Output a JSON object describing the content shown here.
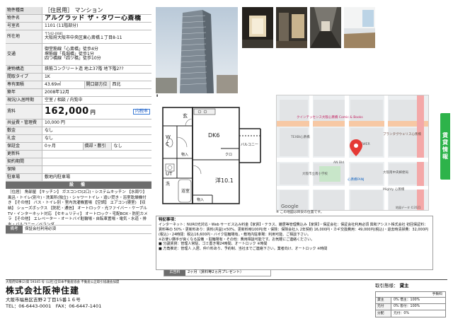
{
  "spec": {
    "type_label": "物件種目",
    "type_value": "［住居用］ マンション",
    "name_label": "物件名",
    "name_value": "アルグラッド ザ・タワー心斎橋",
    "room_label": "号室名",
    "room_value": "1101 (11階部分)",
    "location_label": "所在地",
    "postal": "〒542-0081",
    "address": "大阪府大阪市中央区東心斎橋１丁目8-11",
    "traffic_label": "交通",
    "traffic": [
      "御堂筋線「心斎橋」徒歩4分",
      "堺筋線「長堀橋」徒歩1分",
      "四つ橋線「四ツ橋」徒歩10分"
    ],
    "structure_label": "建物構造",
    "structure_value": "鉄筋コンクリート造 地上37階 地下階2??",
    "layout_label": "間取タイプ",
    "layout_value": "1K",
    "area_label": "専有面積",
    "area_value": "43.69㎡",
    "direction_label": "開口部方位",
    "direction_value": "西北",
    "built_label": "築年",
    "built_value": "2008年12月",
    "status_label": "現況/入居時期",
    "status_value": "空室 / 相談 / 内覧中",
    "rent_label": "賃料",
    "rent_value": "162,000",
    "rent_unit": "円",
    "tax_badge": "内税率",
    "mgmt_label": "共益費・管理費",
    "mgmt_value": "10,000 円",
    "deposit_label": "敷金",
    "deposit_value": "なし",
    "key_label": "礼金",
    "key_value": "なし",
    "guarantee_label": "保証金",
    "guarantee_value": "0ヶ月",
    "amort_label": "償却・敷引",
    "amort_value": "なし",
    "renewal_label": "更新料",
    "renewal_value": "",
    "contract_label": "契約期間",
    "contract_value": "",
    "insurance_label": "保険",
    "insurance_value": "",
    "parking_label": "駐車場",
    "parking_value": "敷地内駐車場",
    "equip_head": "設 備",
    "equipment": "［住居］ 角部屋 【キッチン】 ガスコンロ(2口)・システムキッチン 【水周り】 風呂・トイレ(別々)・洗面所(独立)・シャワートイレ・追い焚き・浴室乾燥機付き 【その他】 バス・トイレ別・室内洗濯機置場 【空調】 エアコン(寝室) 【収納】 シューズボックス 【防犯・通信】 オートロック・光ファイバー・ケーブルTV・インターネット対応 【セキュリティ】 オートロック・宅配BOX・防犯カメラ 【その他】 エレベーター・オートバイ駐輪場・自転車置場・電気・水道・排水・バルコニー／ベランダ",
    "remarks_label": "備考",
    "remarks_value": "保証会社利用必須"
  },
  "floorplan": {
    "north_label": "N",
    "rooms": {
      "genkan": "玄",
      "wc": "W\nC",
      "dk": "DK6",
      "balcony": "バルコニー",
      "closet_top": "物入",
      "closet": "クロ",
      "ut": "UT",
      "washer": "洗",
      "bath": "浴室",
      "western": "洋10.1",
      "storage_bottom": "物入"
    }
  },
  "map": {
    "labels": [
      "クインテッセンス大阪心斎橋 Comic & Books",
      "プランタヴウェリス心斎橋",
      "TEXBI心斎橋",
      "大阪市立南小学校",
      "ANSWER",
      "大阪南中央郵便局",
      "AN Bld",
      "心斎橋FANJ",
      "Mighty 心斎橋"
    ],
    "copyright": "地図データ ©2021",
    "logo": "Google"
  },
  "map_note": "※ この地図は目安の位置です。",
  "side_tab": [
    "賃",
    "貸",
    "情",
    "報"
  ],
  "notes": {
    "head": "特記事項：",
    "body": "インターネット：NURO光対応・Web サービス込み料金【家賃】・テラス、雑居等管理費込み【家賃】・保証会社：保証会社利用必須 興和アシスト株式会社 初回保証料：賃料等の 50%・更新料あり：賃料(共益)×50%、更新料時100円/年・保険：保険会社入 2年契約 16,000円・カギ交換費用：49,000円(税込)・退去時清掃費：32,000円(税込)・24時間：税込16,600円・バイク駐輪場有。・敷地内駐車場：利用可能、ご相談下さい。\n※お使い勝手が良くなる設備 ・駐輪場有・その他：費用相談可能です。お気軽にご連絡ください。\n■ 分譲賃貸：管理人常駐、ゴミ置き場24時間、オートロック ※時間\n■ 方角推定：管理人 入居、仲介料あり、予約制、当社までご連絡下さい。業者向け、オートロック ※時間"
  },
  "adfee": {
    "label": "広告料",
    "value": "2ヶ月（賃料等2ヵ月プレゼント）"
  },
  "company": {
    "license": "大阪府知事(2)第 59345 号 (公社)全日本不動産協会 不動産公正取引協議会加盟",
    "name": "株式会社阪神住建",
    "address": "大阪市福島区吉野２丁目15番１６号",
    "tel": "TEL：06-6443-0001　FAX：06-6447-1401"
  },
  "deal": {
    "label": "取引態様：",
    "value": "貸主",
    "head": "手数料",
    "rows": [
      {
        "k": "貸主",
        "v": "0% 借主：100%"
      },
      {
        "k": "元付",
        "v": "0% 客付：100%"
      },
      {
        "k": "分配",
        "v": "元付：0%"
      }
    ]
  },
  "colors": {
    "accent_green": "#2db34a",
    "section_gray": "#6d6d6d",
    "map_pin": "#e53935"
  }
}
